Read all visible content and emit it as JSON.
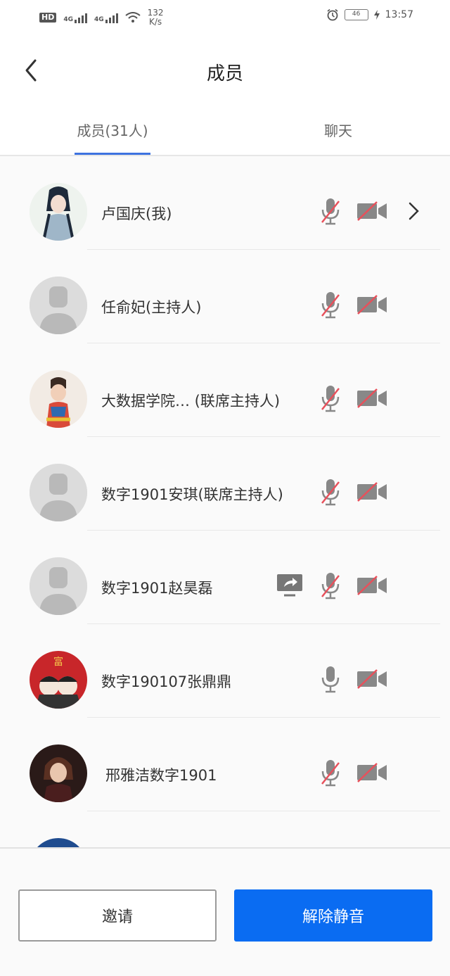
{
  "status_bar": {
    "hd_label": "HD",
    "network1": "4G",
    "network2": "4G",
    "speed_value": "132",
    "speed_unit": "K/s",
    "battery": "46",
    "time": "13:57"
  },
  "header": {
    "title": "成员",
    "back_icon": "chevron-left-icon"
  },
  "tabs": [
    {
      "label": "成员(31人)",
      "active": true
    },
    {
      "label": "聊天",
      "active": false
    }
  ],
  "members": [
    {
      "name": "卢国庆(我)",
      "avatar": "anime-avatar-ink",
      "mic": "muted",
      "camera": "off",
      "sharing": false,
      "has_chevron": true
    },
    {
      "name": "任俞妃(主持人)",
      "avatar": "default",
      "mic": "muted",
      "camera": "off",
      "sharing": false,
      "has_chevron": false
    },
    {
      "name": "大数据学院…  (联席主持人)",
      "avatar": "photo-child",
      "mic": "muted",
      "camera": "off",
      "sharing": false,
      "has_chevron": false
    },
    {
      "name": "数字1901安琪(联席主持人)",
      "avatar": "default",
      "mic": "muted",
      "camera": "off",
      "sharing": false,
      "has_chevron": false
    },
    {
      "name": "数字1901赵昊磊",
      "avatar": "default",
      "mic": "muted",
      "camera": "off",
      "sharing": true,
      "has_chevron": false
    },
    {
      "name": "数字190107张鼎鼎",
      "avatar": "cartoon-red",
      "mic": "on",
      "camera": "off",
      "sharing": false,
      "has_chevron": false
    },
    {
      "name": "邢雅洁数字1901",
      "avatar": "anime-dark",
      "mic": "muted",
      "camera": "off",
      "sharing": false,
      "has_chevron": false
    }
  ],
  "buttons": {
    "invite": "邀请",
    "unmute_all": "解除静音"
  },
  "colors": {
    "accent": "#0a6cf2",
    "tab_indicator": "#3d72e0",
    "muted_slash": "#e8505b",
    "icon_gray": "#888888"
  }
}
